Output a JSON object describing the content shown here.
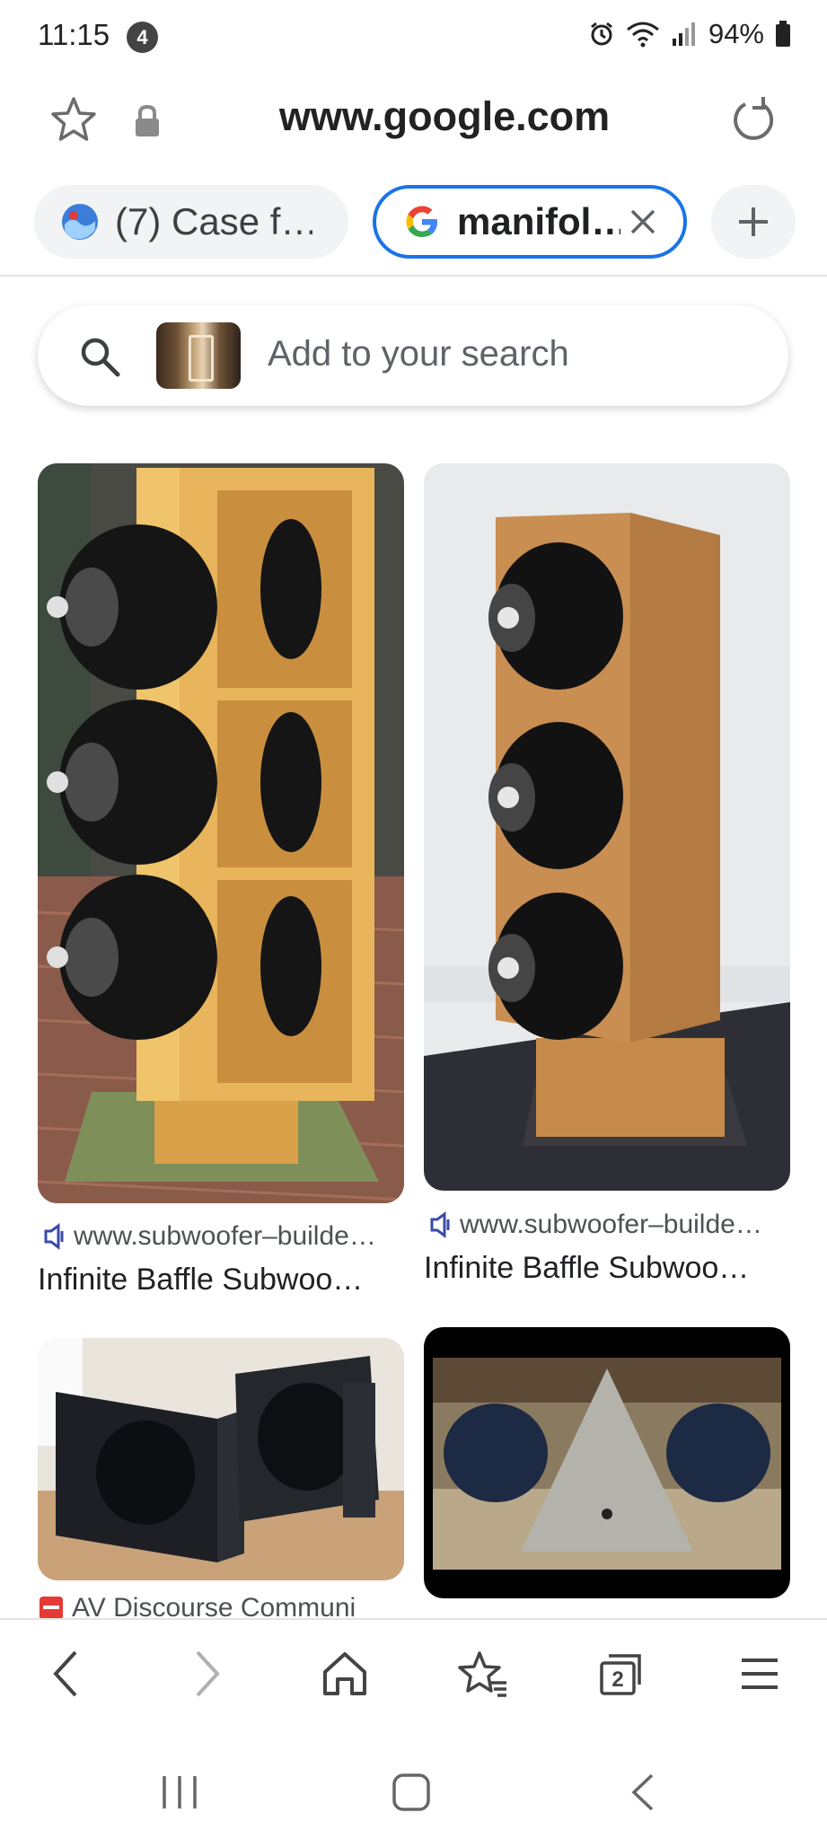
{
  "status_bar": {
    "time": "11:15",
    "notification_count": "4",
    "battery": "94%"
  },
  "address_bar": {
    "url": "www.google.com",
    "icons": [
      "star-icon",
      "lock-icon",
      "reload-icon"
    ]
  },
  "tabs": [
    {
      "label": "(7) Case f…",
      "active": false,
      "favicon": "site-favicon"
    },
    {
      "label": "manifol…",
      "active": true,
      "favicon": "google-g-icon"
    }
  ],
  "search_chip": {
    "placeholder": "Add to your search"
  },
  "results": [
    {
      "source": "www.subwoofer–builde…",
      "title": "Infinite Baffle Subwoo…",
      "source_icon": "speaker-icon"
    },
    {
      "source": "www.subwoofer–builde…",
      "title": "Infinite Baffle Subwoo…",
      "source_icon": "speaker-icon"
    },
    {
      "source": "AV Discourse Communi",
      "title": "",
      "source_icon": "site-favicon"
    },
    {
      "source": "",
      "title": ""
    }
  ],
  "bottom_toolbar": {
    "tab_count": "2",
    "icons": [
      "back-icon",
      "forward-icon",
      "home-icon",
      "bookmarks-icon",
      "tabs-icon",
      "menu-icon"
    ]
  },
  "colors": {
    "accent": "#1a73e8",
    "text": "#202124",
    "muted": "#5f6368"
  }
}
